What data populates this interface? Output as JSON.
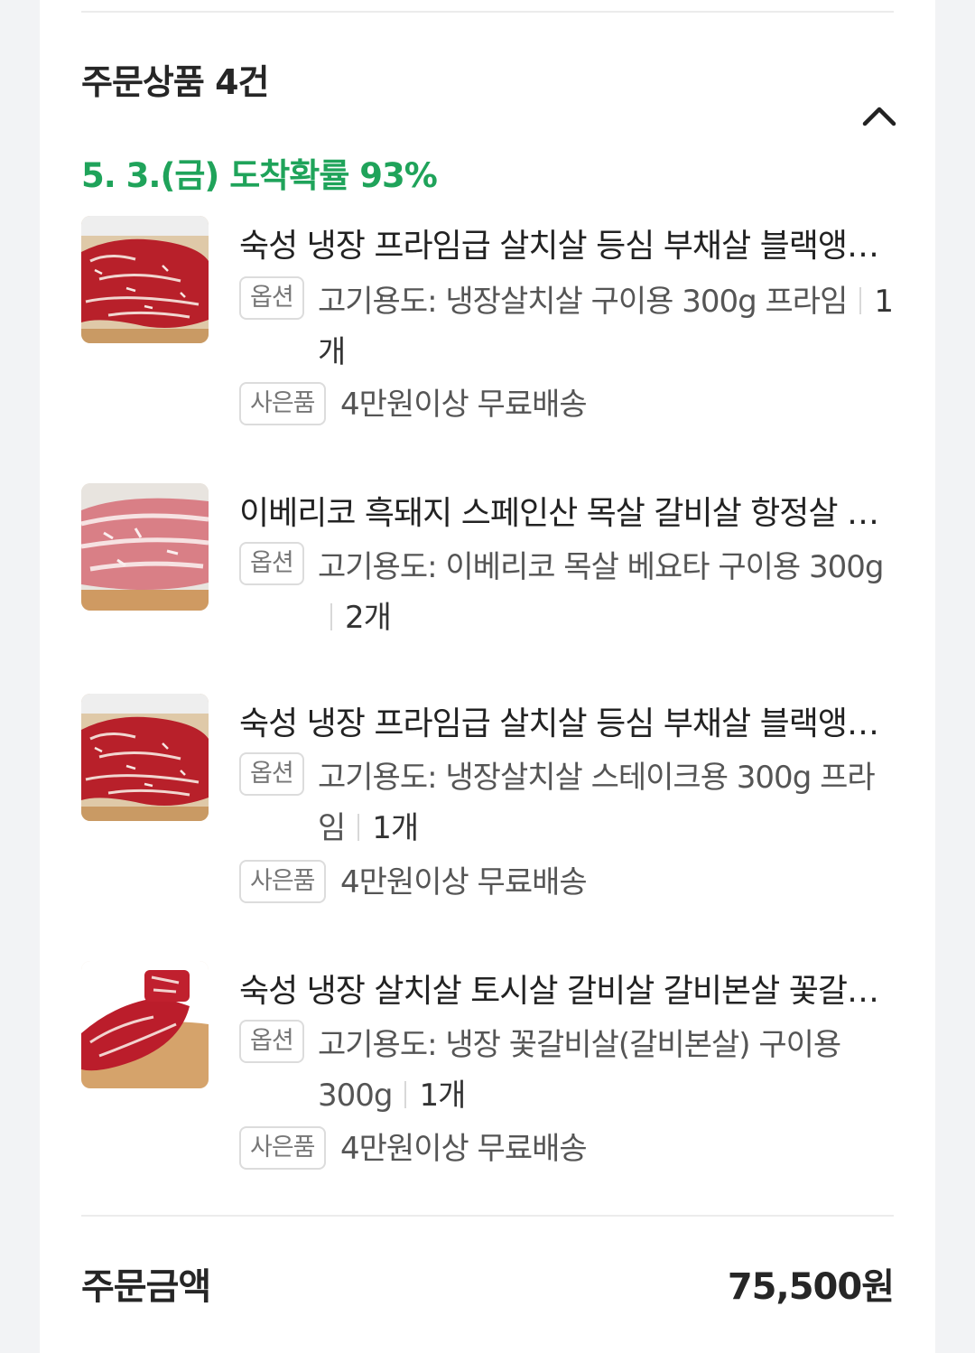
{
  "order_section": {
    "title": "주문상품 4건",
    "delivery_estimate": "5. 3.(금) 도착확률 93%",
    "option_badge_label": "옵션",
    "gift_badge_label": "사은품",
    "items": [
      {
        "title": "숙성 냉장 프라임급 살치살 등심 부채살 블랙앵거스 소고기",
        "option": "고기용도: 냉장살치살 구이용 300g 프라임",
        "quantity": "1개",
        "gift": "4만원이상 무료배송"
      },
      {
        "title": "이베리코 흑돼지 스페인산 목살 갈비살 항정살 베요타",
        "option": "고기용도: 이베리코 목살 베요타 구이용 300g",
        "quantity": "2개"
      },
      {
        "title": "숙성 냉장 프라임급 살치살 등심 부채살 블랙앵거스 소고기",
        "option": "고기용도: 냉장살치살 스테이크용 300g 프라임",
        "quantity": "1개",
        "gift": "4만원이상 무료배송"
      },
      {
        "title": "숙성 냉장 살치살 토시살 갈비살 갈비본살 꽃갈비살",
        "option": "고기용도: 냉장 꽃갈비살(갈비본살) 구이용 300g",
        "quantity": "1개",
        "gift": "4만원이상 무료배송"
      }
    ]
  },
  "order_total": {
    "label": "주문금액",
    "value": "75,500원"
  },
  "colors": {
    "delivery_green": "#1fa35a",
    "background": "#f2f3f5",
    "card": "#ffffff"
  },
  "icons": {
    "collapse": "chevron-up-icon"
  }
}
